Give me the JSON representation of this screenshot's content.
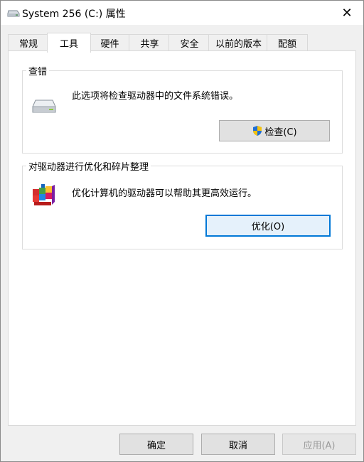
{
  "window": {
    "title": "System 256 (C:) 属性",
    "close_glyph": "✕"
  },
  "tabs": [
    {
      "label": "常规"
    },
    {
      "label": "工具",
      "active": true
    },
    {
      "label": "硬件"
    },
    {
      "label": "共享"
    },
    {
      "label": "安全"
    },
    {
      "label": "以前的版本"
    },
    {
      "label": "配额"
    }
  ],
  "error_check": {
    "title": "查错",
    "description": "此选项将检查驱动器中的文件系统错误。",
    "icon": "drive-icon",
    "button_label": "检查(C)",
    "button_icon": "uac-shield-icon"
  },
  "optimize": {
    "title": "对驱动器进行优化和碎片整理",
    "description": "优化计算机的驱动器可以帮助其更高效运行。",
    "icon": "defrag-icon",
    "button_label": "优化(O)"
  },
  "footer": {
    "ok_label": "确定",
    "cancel_label": "取消",
    "apply_label": "应用(A)"
  },
  "colors": {
    "accent": "#0078d7",
    "panel_bg": "#ffffff",
    "dialog_bg": "#f0f0f0"
  }
}
